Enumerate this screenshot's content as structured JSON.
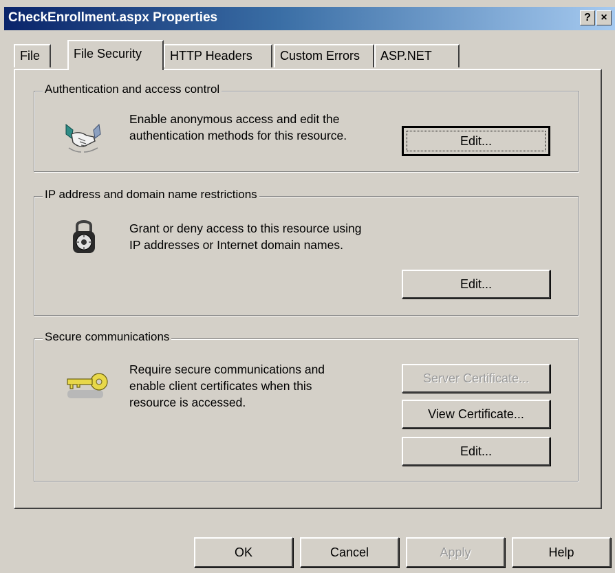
{
  "window": {
    "title": "CheckEnrollment.aspx Properties",
    "help_button": "?",
    "close_button": "×"
  },
  "tabs": [
    {
      "label": "File"
    },
    {
      "label": "File Security"
    },
    {
      "label": "HTTP Headers"
    },
    {
      "label": "Custom Errors"
    },
    {
      "label": "ASP.NET"
    }
  ],
  "groups": {
    "auth": {
      "legend": "Authentication and access control",
      "line1": "Enable anonymous access and edit the",
      "line2": "authentication methods for this resource.",
      "edit": "Edit...",
      "icon": "handshake-icon"
    },
    "ip": {
      "legend": "IP address and domain name restrictions",
      "line1": "Grant or deny access to this resource using",
      "line2": "IP addresses or Internet domain names.",
      "edit": "Edit...",
      "icon": "padlock-icon"
    },
    "secure": {
      "legend": "Secure communications",
      "line1": "Require secure communications and",
      "line2": "enable client certificates when this",
      "line3": "resource is accessed.",
      "server_cert": "Server Certificate...",
      "view_cert": "View Certificate...",
      "edit": "Edit...",
      "icon": "key-icon"
    }
  },
  "footer": {
    "ok": "OK",
    "cancel": "Cancel",
    "apply": "Apply",
    "help": "Help"
  },
  "colors": {
    "dialog_bg": "#d4d0c8",
    "title_start": "#0a246a",
    "title_end": "#a6caf0"
  }
}
